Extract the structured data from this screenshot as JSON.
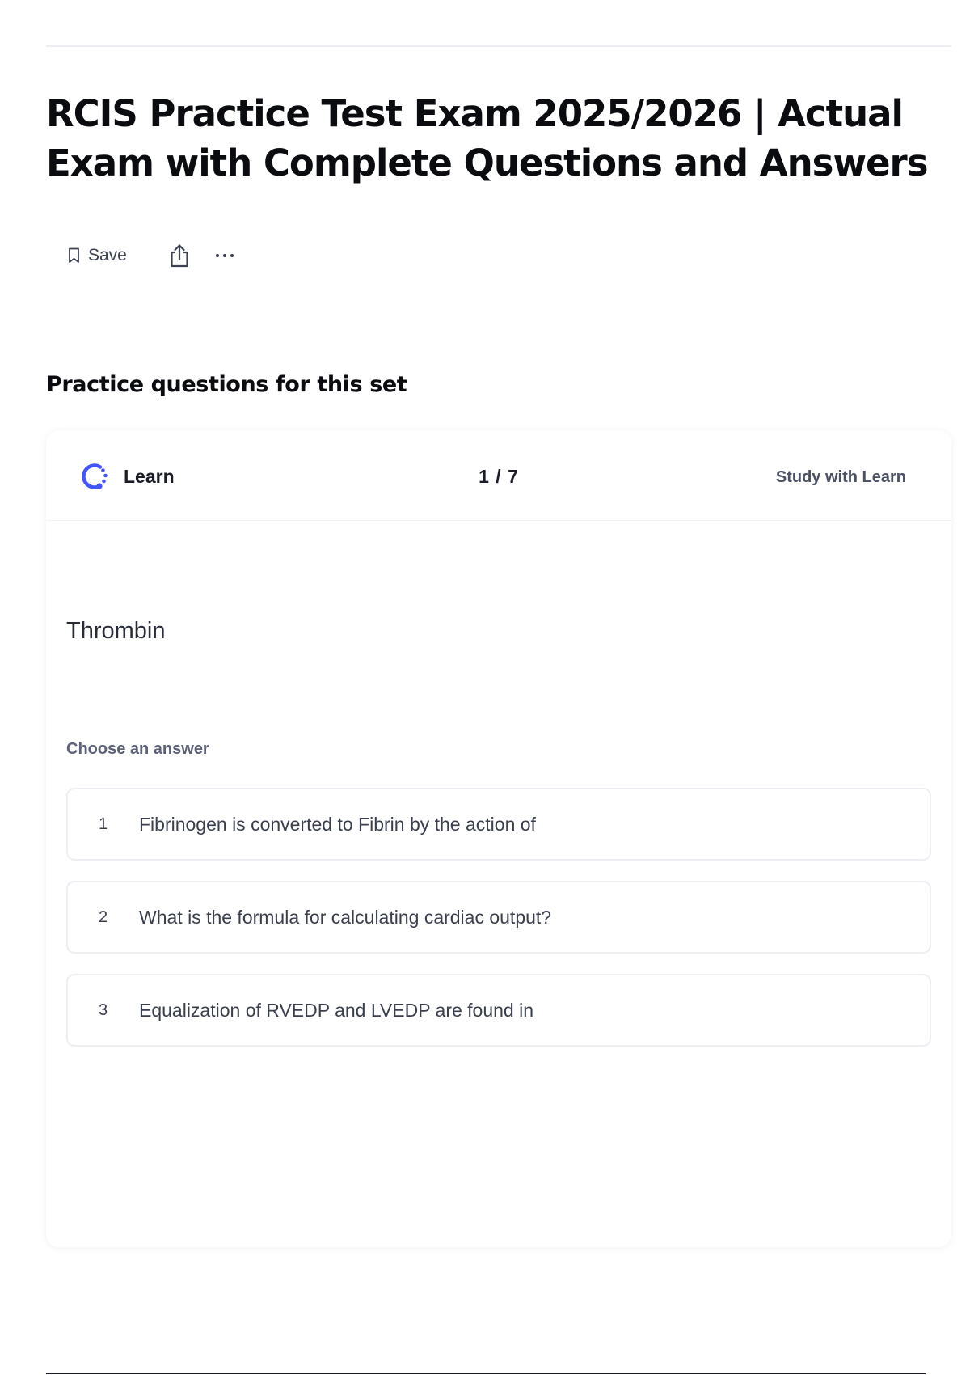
{
  "header": {
    "title": "RCIS Practice Test Exam 2025/2026 | Actual Exam with Complete Questions and Answers",
    "actions": {
      "save_label": "Save",
      "icons": [
        "bookmark-icon",
        "share-icon",
        "more-icon"
      ]
    }
  },
  "practice": {
    "heading": "Practice questions for this set",
    "card": {
      "mode_label": "Learn",
      "mode_icon": "learn-icon",
      "progress": "1 / 7",
      "study_link": "Study with Learn",
      "term": "Thrombin",
      "prompt": "Choose an answer",
      "options": [
        {
          "number": "1",
          "text": "Fibrinogen is converted to Fibrin by the action of"
        },
        {
          "number": "2",
          "text": "What is the formula for calculating cardiac output?"
        },
        {
          "number": "3",
          "text": "Equalization of RVEDP and LVEDP are found in"
        }
      ]
    }
  },
  "colors": {
    "accent": "#4255ff",
    "title_text": "#0b0c10",
    "muted_text": "#5b6178",
    "option_border": "#edeff3"
  }
}
